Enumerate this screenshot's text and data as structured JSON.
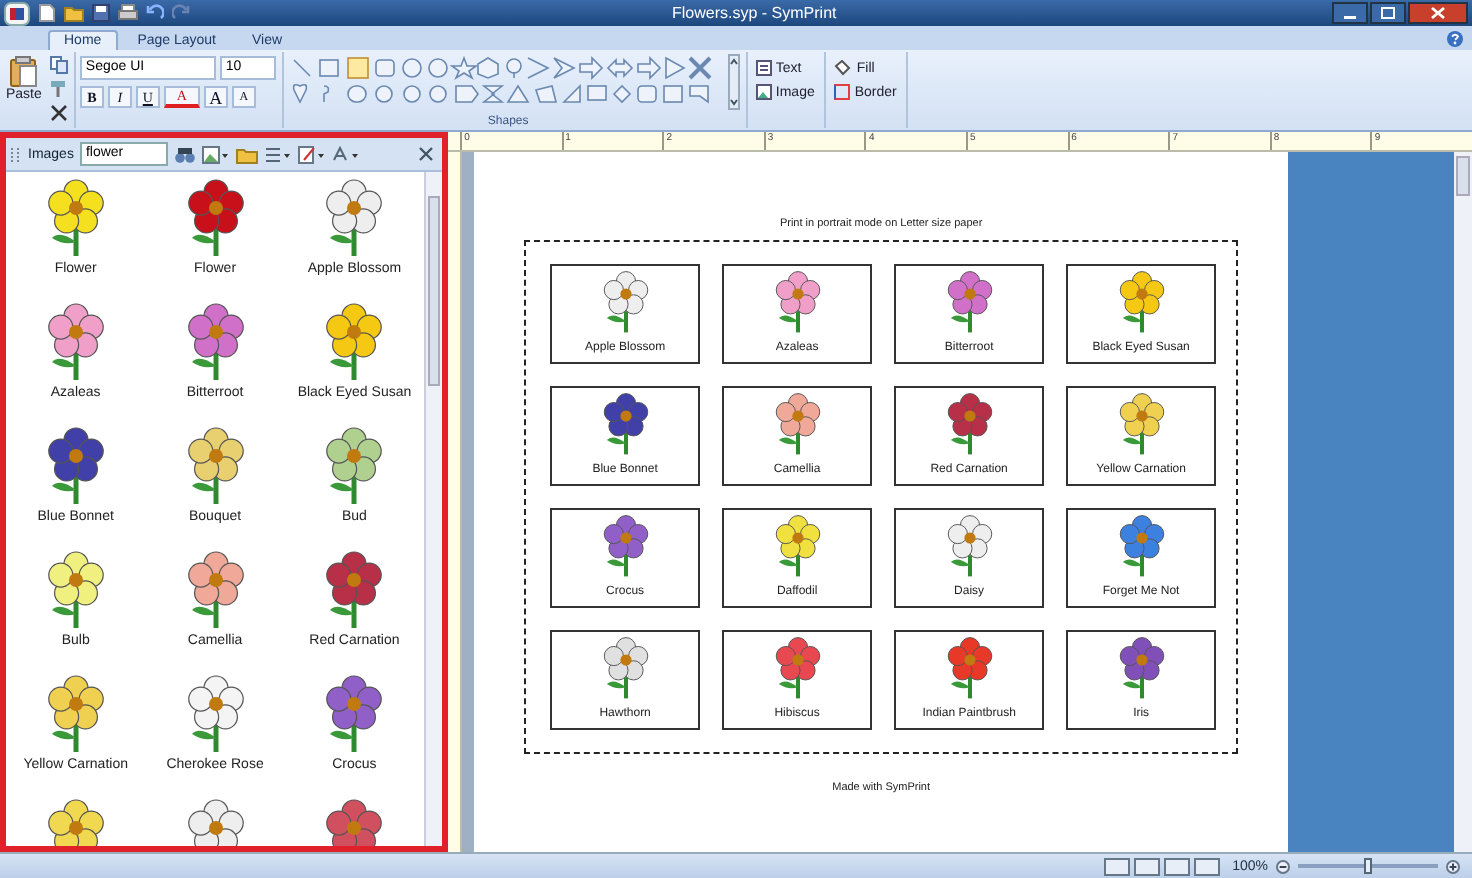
{
  "window": {
    "title": "Flowers.syp - SymPrint"
  },
  "tabs": [
    {
      "label": "Home",
      "selected": true
    },
    {
      "label": "Page Layout",
      "selected": false
    },
    {
      "label": "View",
      "selected": false
    }
  ],
  "ribbon": {
    "paste": "Paste",
    "font": "Segoe UI",
    "size": "10",
    "format_buttons": [
      "B",
      "I",
      "U"
    ],
    "font_color": "A",
    "grow": "A",
    "shrink": "A",
    "shapes_group": "Shapes",
    "text": "Text",
    "image": "Image",
    "fill": "Fill",
    "border": "Border"
  },
  "panel": {
    "title": "Images",
    "search": "flower",
    "items": [
      {
        "label": "Flower",
        "color": "#f5e020"
      },
      {
        "label": "Flower",
        "color": "#c8101a"
      },
      {
        "label": "Apple Blossom",
        "color": "#eeeeee"
      },
      {
        "label": "Azaleas",
        "color": "#f0a0c8"
      },
      {
        "label": "Bitterroot",
        "color": "#d070c8"
      },
      {
        "label": "Black Eyed Susan",
        "color": "#f5c814"
      },
      {
        "label": "Blue Bonnet",
        "color": "#4040a8"
      },
      {
        "label": "Bouquet",
        "color": "#e8d070"
      },
      {
        "label": "Bud",
        "color": "#b0d090"
      },
      {
        "label": "Bulb",
        "color": "#f0f080"
      },
      {
        "label": "Camellia",
        "color": "#f0a898"
      },
      {
        "label": "Red Carnation",
        "color": "#b83048"
      },
      {
        "label": "Yellow Carnation",
        "color": "#f0d050"
      },
      {
        "label": "Cherokee Rose",
        "color": "#f4f4f4"
      },
      {
        "label": "Crocus",
        "color": "#9060c8"
      },
      {
        "color": "#f0d850"
      },
      {
        "color": "#eeeeee"
      },
      {
        "color": "#d05060"
      }
    ]
  },
  "ruler": [
    "0",
    "1",
    "2",
    "3",
    "4",
    "5",
    "6",
    "7",
    "8",
    "9"
  ],
  "page": {
    "header": "Print in portrait mode on Letter size paper",
    "cards": [
      {
        "label": "Apple Blossom",
        "color": "#eeeeee"
      },
      {
        "label": "Azaleas",
        "color": "#f0a0c8"
      },
      {
        "label": "Bitterroot",
        "color": "#d070c8"
      },
      {
        "label": "Black Eyed Susan",
        "color": "#f5c814"
      },
      {
        "label": "Blue Bonnet",
        "color": "#4040a8"
      },
      {
        "label": "Camellia",
        "color": "#f0a898"
      },
      {
        "label": "Red Carnation",
        "color": "#b83048"
      },
      {
        "label": "Yellow Carnation",
        "color": "#f0d050"
      },
      {
        "label": "Crocus",
        "color": "#9060c8"
      },
      {
        "label": "Daffodil",
        "color": "#f0e040"
      },
      {
        "label": "Daisy",
        "color": "#eeeeee"
      },
      {
        "label": "Forget Me Not",
        "color": "#3c80e0"
      },
      {
        "label": "Hawthorn",
        "color": "#e0e0e0"
      },
      {
        "label": "Hibiscus",
        "color": "#e84850"
      },
      {
        "label": "Indian Paintbrush",
        "color": "#e83828"
      },
      {
        "label": "Iris",
        "color": "#8050b8"
      }
    ],
    "footer": "Made with SymPrint"
  },
  "status_bar": {
    "zoom": "100%",
    "level": 0.5
  }
}
